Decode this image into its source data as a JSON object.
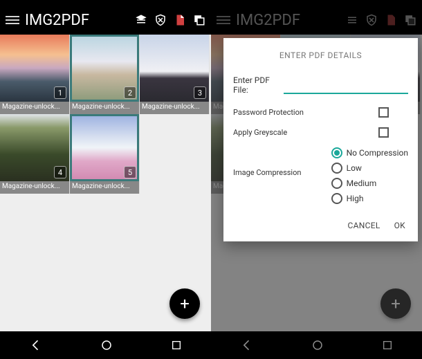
{
  "app": {
    "title": "IMG2PDF"
  },
  "grid": {
    "items": [
      {
        "num": "1",
        "filename": "Magazine-unlock..."
      },
      {
        "num": "2",
        "filename": "Magazine-unlock..."
      },
      {
        "num": "3",
        "filename": "Magazine-unlock..."
      },
      {
        "num": "4",
        "filename": "Magazine-unlock..."
      },
      {
        "num": "5",
        "filename": "Magazine-unlock..."
      }
    ]
  },
  "fab": {
    "glyph": "+"
  },
  "dialog": {
    "title": "ENTER PDF DETAILS",
    "file_label": "Enter PDF File:",
    "file_value": "",
    "password_label": "Password Protection",
    "greyscale_label": "Apply Greyscale",
    "compression_label": "Image Compression",
    "radios": {
      "none": "No Compression",
      "low": "Low",
      "medium": "Medium",
      "high": "High"
    },
    "cancel": "CANCEL",
    "ok": "OK"
  }
}
